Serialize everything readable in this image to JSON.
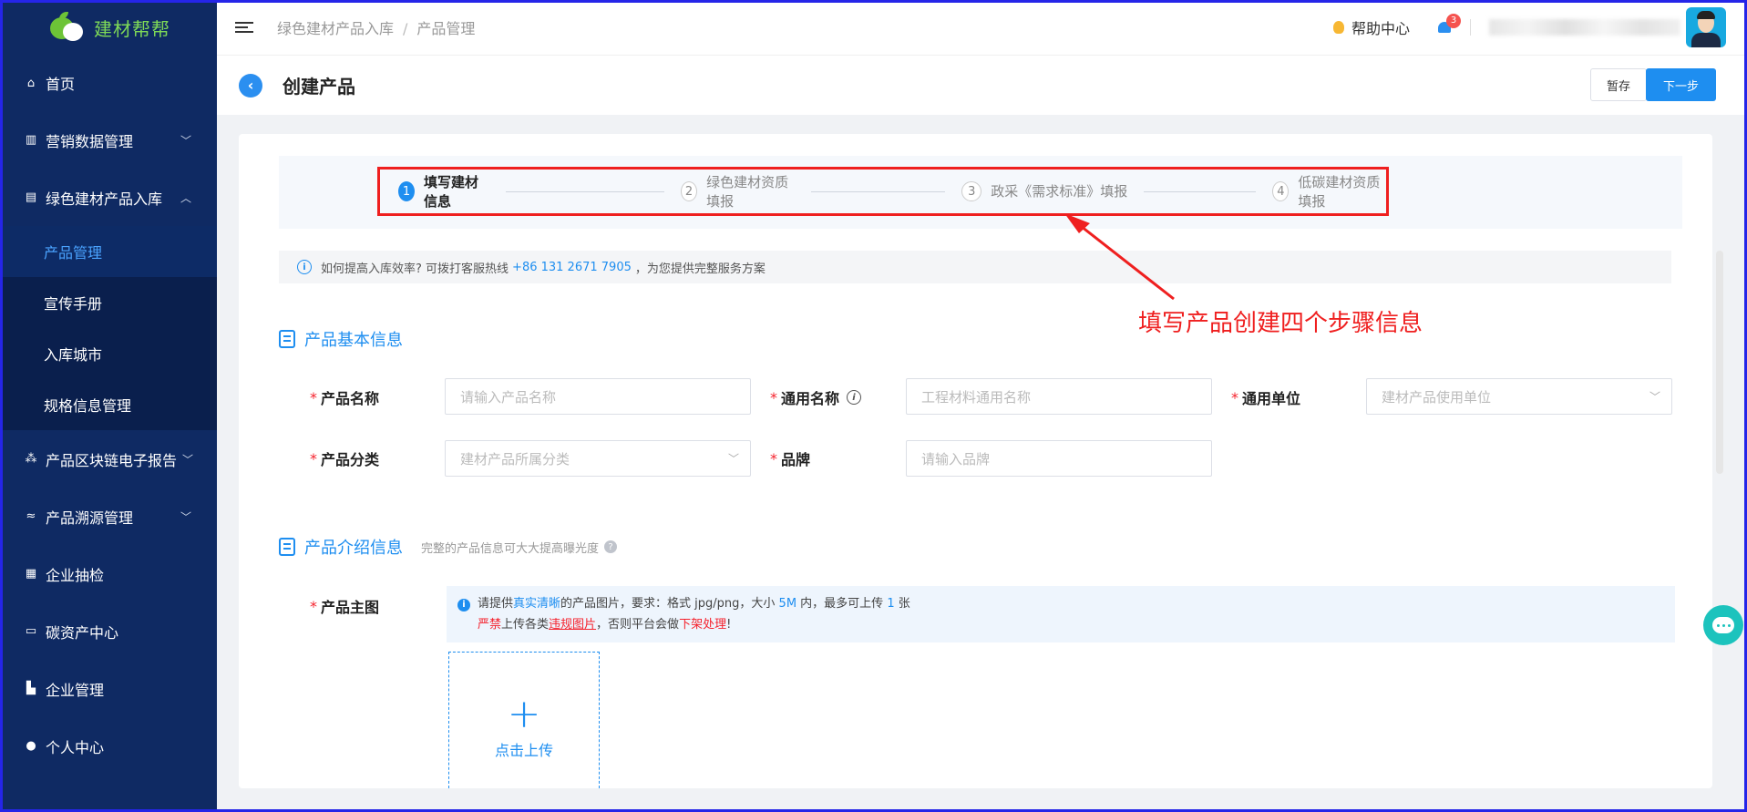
{
  "brand": {
    "name": "建材帮帮",
    "colors": {
      "sidebar": "#0f2a63",
      "accent": "#1e8ef0",
      "logo_green": "#6dc437",
      "annotation": "#ef1f1f"
    }
  },
  "sidebar": {
    "items": [
      {
        "label": "首页",
        "icon": "home-icon"
      },
      {
        "label": "营销数据管理",
        "icon": "chart-icon",
        "chevron": "﹀"
      },
      {
        "label": "绿色建材产品入库",
        "icon": "box-icon",
        "chevron": "︿"
      },
      {
        "label": "产品区块链电子报告",
        "icon": "blockchain-icon",
        "chevron": "﹀"
      },
      {
        "label": "产品溯源管理",
        "icon": "trace-icon",
        "chevron": "﹀"
      },
      {
        "label": "企业抽检",
        "icon": "clipboard-icon"
      },
      {
        "label": "碳资产中心",
        "icon": "co2-icon"
      },
      {
        "label": "企业管理",
        "icon": "building-icon"
      },
      {
        "label": "个人中心",
        "icon": "user-icon"
      }
    ],
    "submenu": [
      "产品管理",
      "宣传手册",
      "入库城市",
      "规格信息管理"
    ]
  },
  "header": {
    "breadcrumb": [
      "绿色建材产品入库",
      "产品管理"
    ],
    "breadcrumb_sep": "/",
    "help": "帮助中心",
    "notif_count": "3"
  },
  "titlebar": {
    "title": "创建产品",
    "draft": "暂存",
    "next": "下一步"
  },
  "steps": [
    {
      "num": "1",
      "label": "填写建材信息"
    },
    {
      "num": "2",
      "label": "绿色建材资质填报"
    },
    {
      "num": "3",
      "label": "政采《需求标准》填报"
    },
    {
      "num": "4",
      "label": "低碳建材资质填报"
    }
  ],
  "notice": {
    "text1": "如何提高入库效率? 可拨打客服热线",
    "phone": "+86 131 2671 7905",
    "text2": "，为您提供完整服务方案"
  },
  "section_basic": {
    "title": "产品基本信息"
  },
  "fields": {
    "product_name": {
      "label": "产品名称",
      "placeholder": "请输入产品名称"
    },
    "common_name": {
      "label": "通用名称",
      "placeholder": "工程材料通用名称"
    },
    "common_unit": {
      "label": "通用单位",
      "placeholder": "建材产品使用单位"
    },
    "category": {
      "label": "产品分类",
      "placeholder": "建材产品所属分类"
    },
    "brand": {
      "label": "品牌",
      "placeholder": "请输入品牌"
    }
  },
  "section_intro": {
    "title": "产品介绍信息",
    "hint": "完整的产品信息可大大提高曝光度"
  },
  "main_image": {
    "label": "产品主图",
    "tip": {
      "a": "请提供",
      "b": "真实清晰",
      "c": "的产品图片，要求：格式 jpg/png，大小 ",
      "d": "5M",
      "e": " 内，最多可上传 ",
      "f": "1",
      "g": " 张",
      "h": "严禁",
      "i": "上传各类",
      "j": "违规图片",
      "k": "，否则平台会做",
      "l": "下架处理",
      "m": "!"
    },
    "upload": "点击上传"
  },
  "annotation": "填写产品创建四个步骤信息"
}
